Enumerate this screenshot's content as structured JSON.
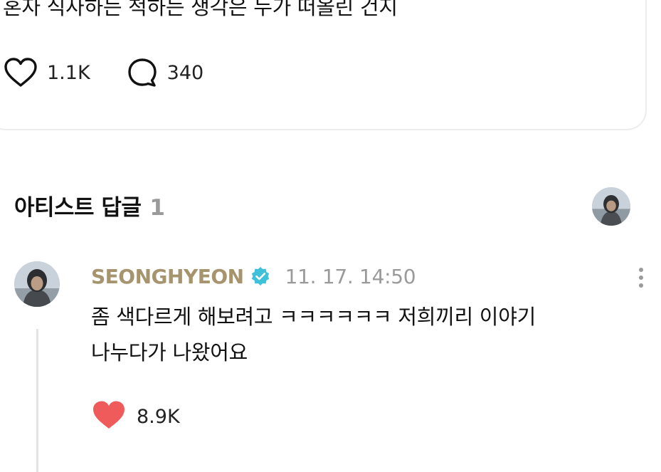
{
  "post": {
    "text": "혼자 식사하는 척하는 생각은 누가 떠올린 건지",
    "likes": "1.1K",
    "comments": "340"
  },
  "artist_replies": {
    "title": "아티스트 답글",
    "count": "1"
  },
  "reply": {
    "author": "SEONGHYEON",
    "time": "11. 17. 14:50",
    "lines": [
      "좀 색다르게 해보려고 ㅋㅋㅋㅋㅋㅋ 저희끼리 이야기",
      "나누다가 나왔어요"
    ],
    "likes": "8.9K",
    "like_color": "#ef5a5a"
  },
  "colors": {
    "author": "#a5946e",
    "verified_badge": "#3fc1d9",
    "muted": "#9a9a9a"
  },
  "icons": {
    "like": "heart-outline-icon",
    "comment": "speech-bubble-icon",
    "verified": "verified-badge-icon",
    "liked": "heart-filled-icon",
    "more": "more-vertical-icon"
  }
}
